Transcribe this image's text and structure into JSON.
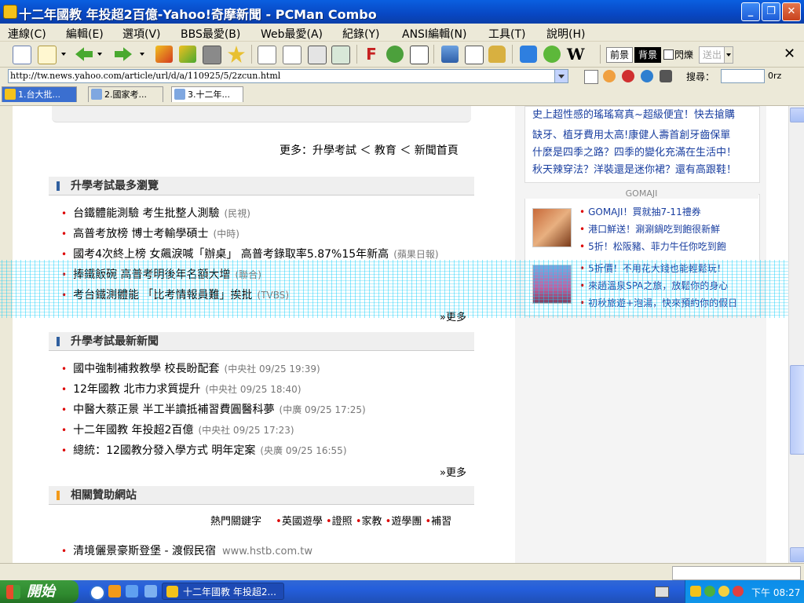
{
  "window": {
    "title": "十二年國教 年投超2百億-Yahoo!奇摩新聞 - PCMan Combo"
  },
  "menu": [
    "連線(C)",
    "編輯(E)",
    "選項(V)",
    "BBS最愛(B)",
    "Web最愛(A)",
    "紀錄(Y)",
    "ANSI編輯(N)",
    "工具(T)",
    "說明(H)"
  ],
  "toolbar": {
    "fg_label": "前景",
    "bg_label": "背景",
    "blink_label": "閃爍",
    "send_label": "送出",
    "close_tab": "✕"
  },
  "address": {
    "url": "http://tw.news.yahoo.com/article/url/d/a/110925/5/2zcun.html",
    "search_label": "搜尋：",
    "zoom": "0rz"
  },
  "tabs": [
    {
      "label": "1.台大批..."
    },
    {
      "label": "2.國家考..."
    },
    {
      "label": "3.十二年..."
    }
  ],
  "main": {
    "more_line": "更多：升學考試 ＜ 教育 ＜ 新聞首頁",
    "section1": {
      "title": "升學考試最多瀏覽",
      "items": [
        {
          "text": "台鐵體能測驗 考生批整人測驗",
          "src": "(民視)"
        },
        {
          "text": "高普考放榜 博士考輸學碩士",
          "src": "(中時)"
        },
        {
          "text": "國考4次終上榜 女飆淚喊「辦桌」 高普考錄取率5.87%15年新高",
          "src": "(蘋果日報)"
        },
        {
          "text": "捧鐵飯碗 高普考明後年名額大增",
          "src": "(聯合)"
        },
        {
          "text": "考台鐵測體能 「比考情報員難」挨批",
          "src": "(TVBS)"
        }
      ],
      "more": "»更多"
    },
    "section2": {
      "title": "升學考試最新新聞",
      "items": [
        {
          "text": "國中強制補救教學 校長盼配套",
          "src": "(中央社 09/25 19:39)"
        },
        {
          "text": "12年國教 北市力求質提升",
          "src": "(中央社 09/25 18:40)"
        },
        {
          "text": "中醫大蔡正景 半工半讀抵補習費圓醫科夢",
          "src": "(中廣 09/25 17:25)"
        },
        {
          "text": "十二年國教 年投超2百億",
          "src": "(中央社 09/25 17:23)"
        },
        {
          "text": "總統：12國教分發入學方式 明年定案",
          "src": "(央廣 09/25 16:55)"
        }
      ],
      "more": "»更多"
    },
    "section3": {
      "title": "相關贊助網站",
      "keywords_label": "熱門關鍵字",
      "keywords": [
        "英國遊學",
        "證照",
        "家教",
        "遊學團",
        "補習"
      ],
      "sponsor_title": "清境儷景豪斯登堡 - 渡假民宿",
      "sponsor_url": "www.hstb.com.tw"
    }
  },
  "right": {
    "ads": [
      "史上超性感的瑤瑤寫真~超級便宜！快去搶購",
      "缺牙、植牙費用太高!康健人壽首創牙齒保單",
      "什麼是四季之路？四季的變化充滿在生活中！",
      "秋天辣穿法？洋裝還是迷你裙？還有高跟鞋！"
    ],
    "gomaji": {
      "title": "GOMAJI",
      "group1": [
        "GOMAJI！買就抽7-11禮券",
        "港口鮮送！涮涮鍋吃到飽很新鮮",
        "5折！松阪豬、菲力牛任你吃到飽"
      ],
      "group2": [
        "5折價！不用花大錢也能輕鬆玩！",
        "來趟溫泉SPA之旅，放鬆你的身心",
        "初秋旅遊+泡湯，快來預約你的假日"
      ]
    }
  },
  "taskbar": {
    "start": "開始",
    "task": "十二年國教 年投超2...",
    "clock": "下午 08:27"
  },
  "colors": {
    "titlebar": "#0A5FE0",
    "link_blue": "#1A3FA0",
    "bullet_red": "#DD0000",
    "start_green": "#2F8A2F"
  }
}
